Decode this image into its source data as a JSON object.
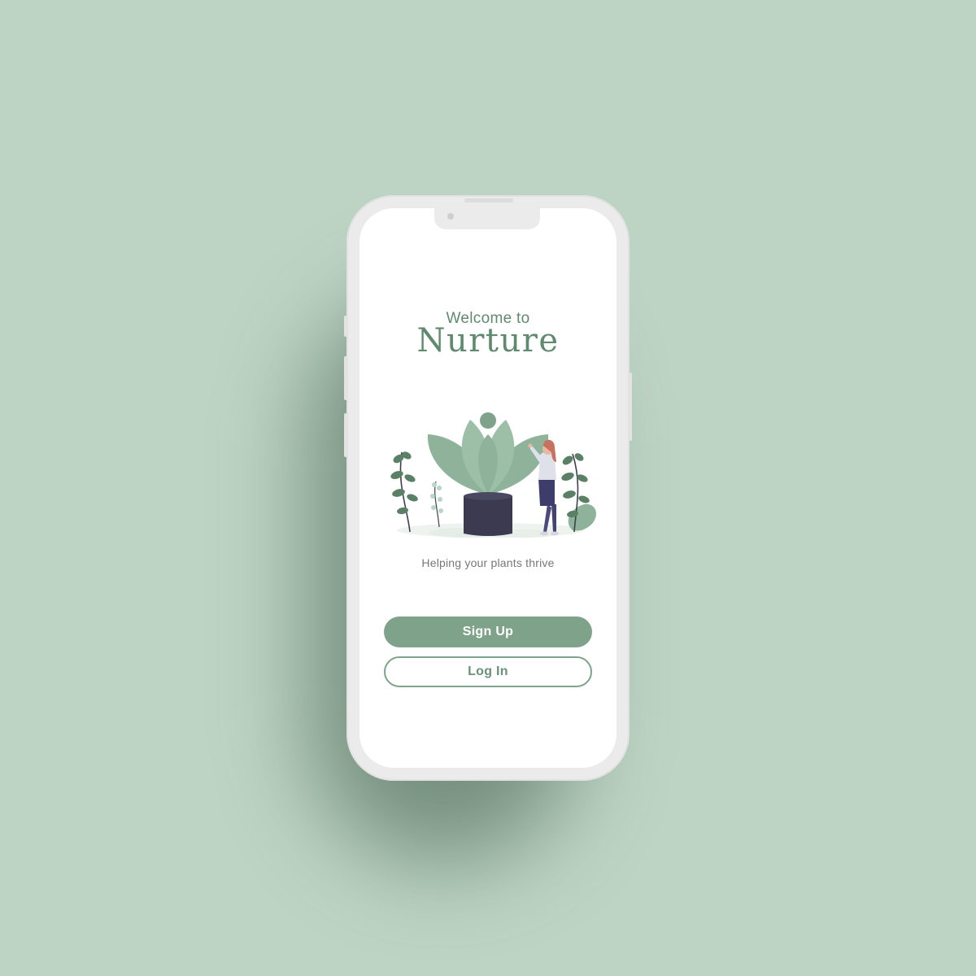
{
  "app": {
    "welcome_text": "Welcome to",
    "name": "Nurture",
    "tagline": "Helping your plants thrive"
  },
  "actions": {
    "signup_label": "Sign Up",
    "login_label": "Log In"
  },
  "colors": {
    "background": "#bdd3c4",
    "accent": "#7fa38a",
    "brand_text": "#5f8a6e",
    "pot": "#3b3a50"
  },
  "illustration": {
    "icon": "plant-care-illustration"
  }
}
